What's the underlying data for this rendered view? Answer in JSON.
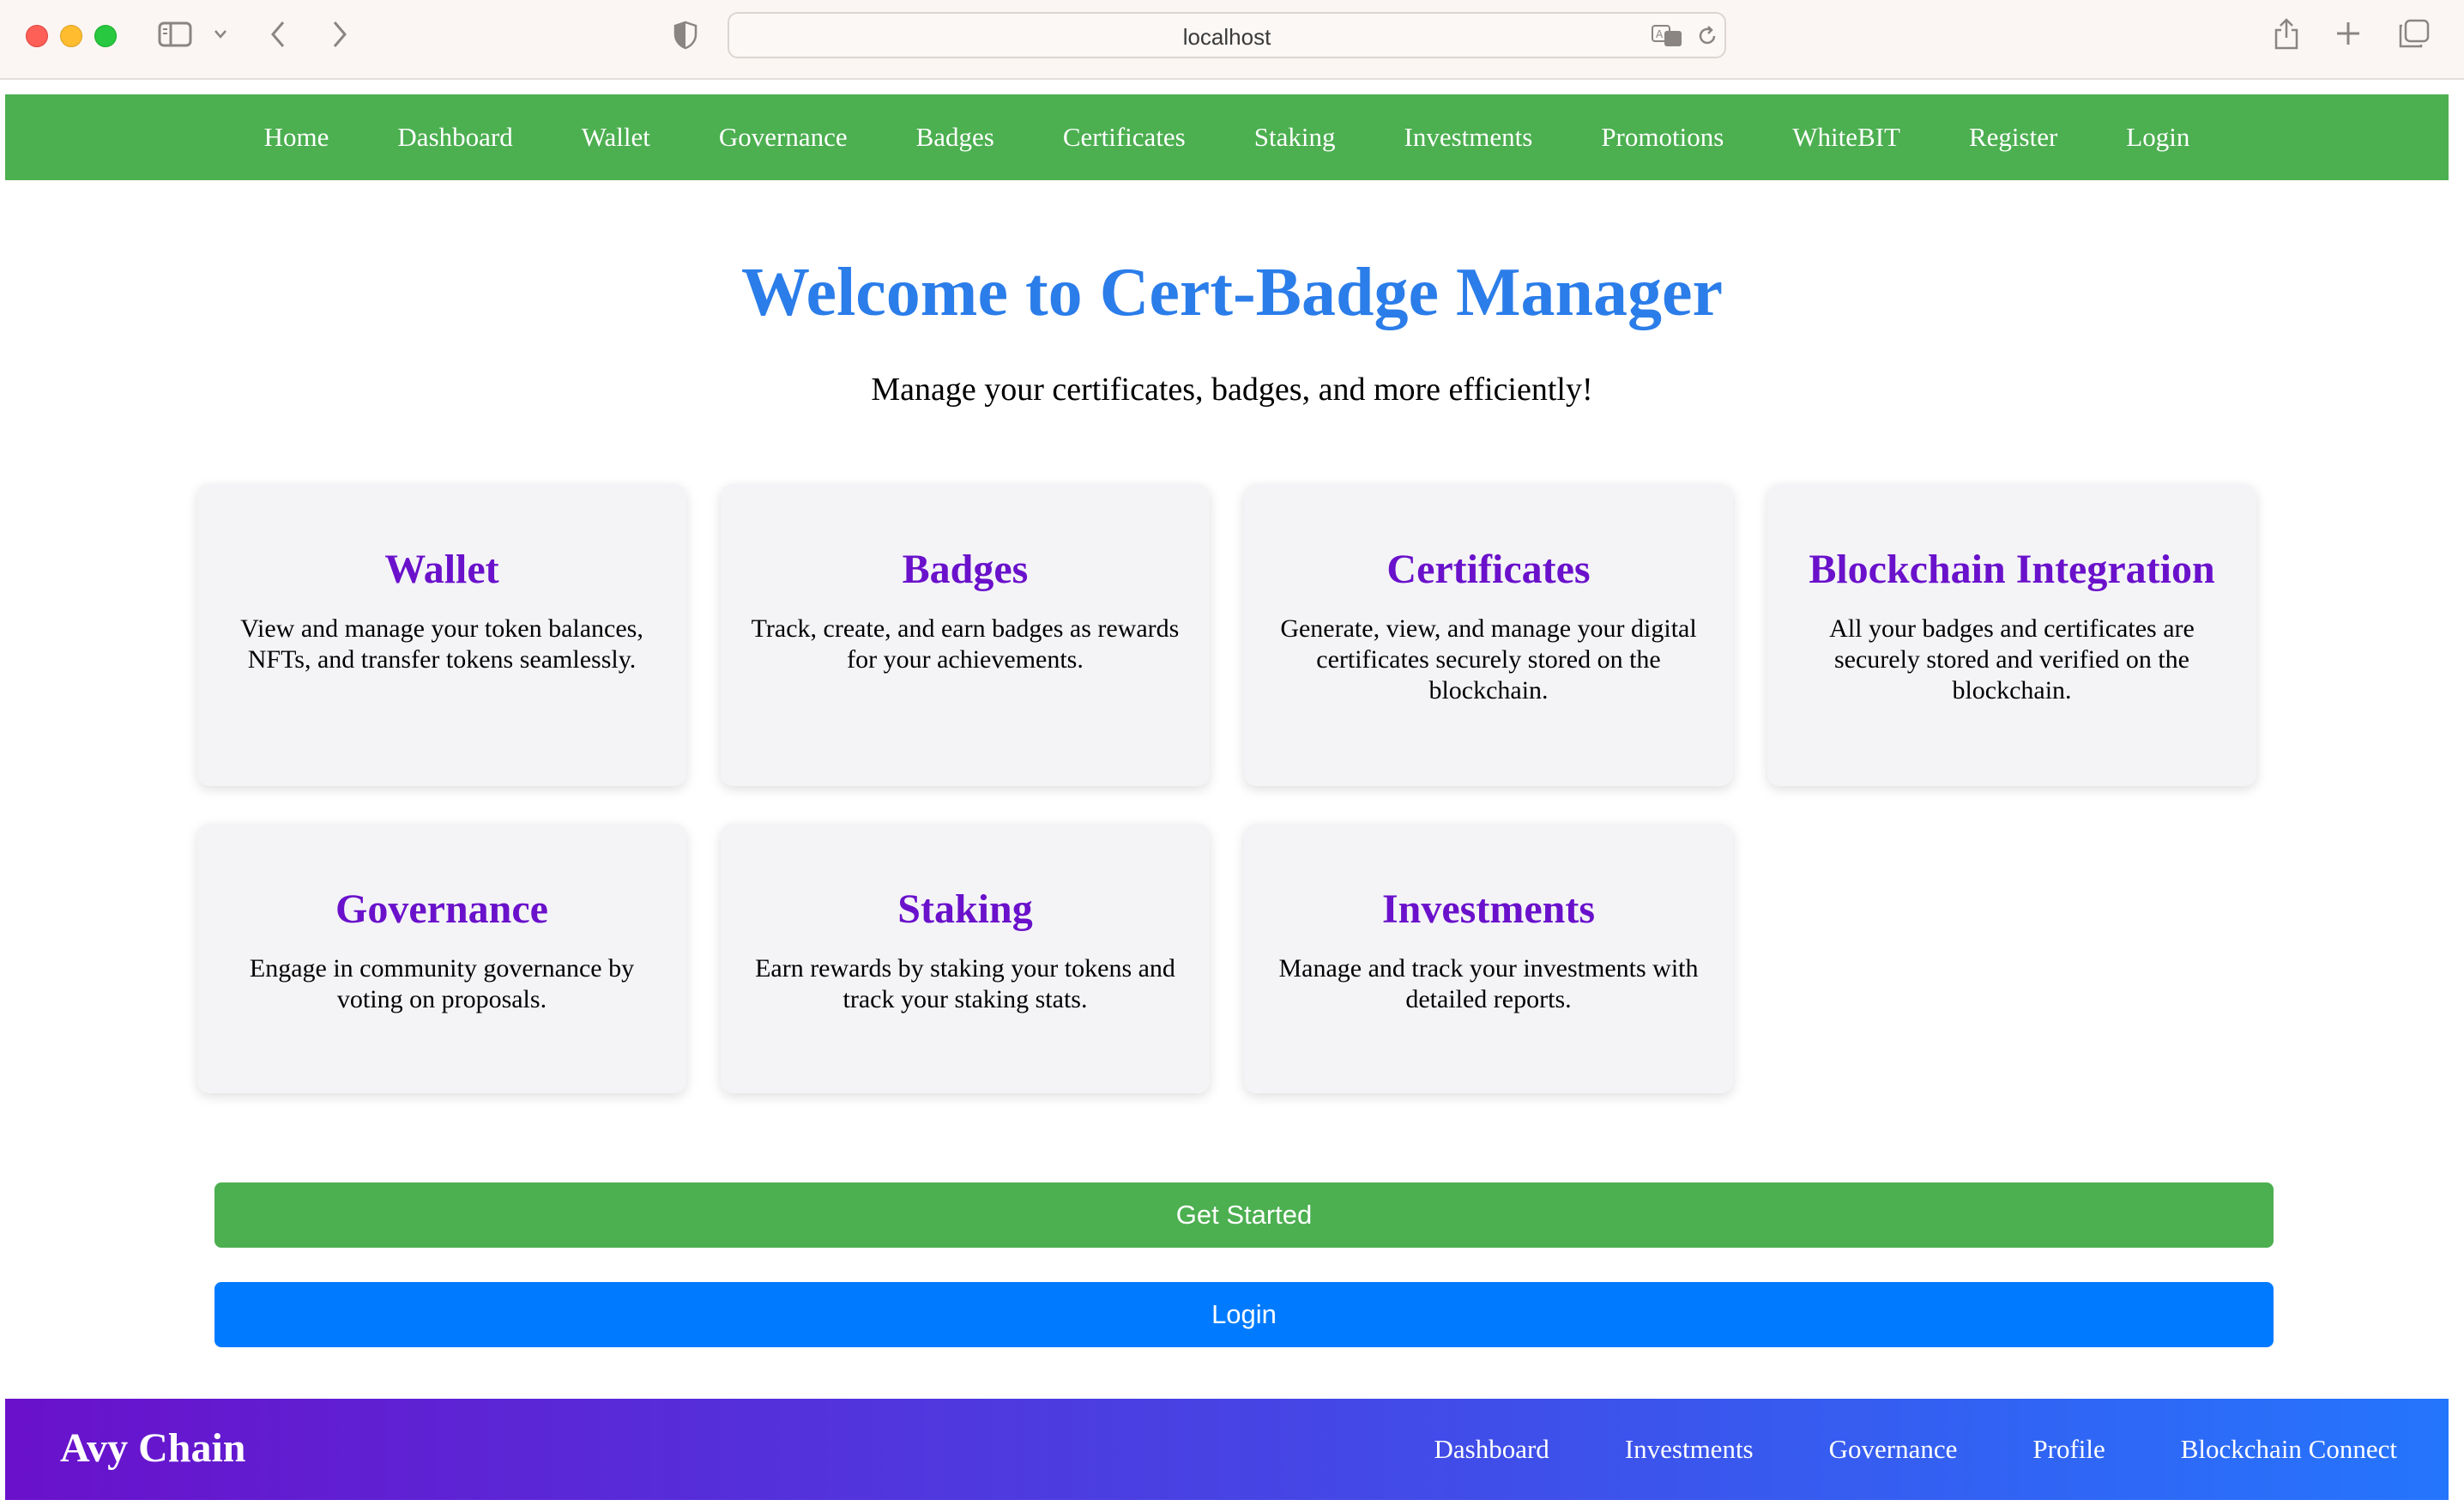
{
  "browser": {
    "url": "localhost",
    "icons": [
      "sidebar-icon",
      "chevron-down-icon",
      "back-icon",
      "forward-icon",
      "shield-icon",
      "translate-icon",
      "reload-icon",
      "share-icon",
      "new-tab-icon",
      "tabs-overview-icon"
    ]
  },
  "nav": {
    "items": [
      "Home",
      "Dashboard",
      "Wallet",
      "Governance",
      "Badges",
      "Certificates",
      "Staking",
      "Investments",
      "Promotions",
      "WhiteBIT",
      "Register",
      "Login"
    ]
  },
  "hero": {
    "title": "Welcome to Cert-Badge Manager",
    "subtitle": "Manage your certificates, badges, and more efficiently!"
  },
  "cards": [
    {
      "title": "Wallet",
      "text": "View and manage your token balances, NFTs, and transfer tokens seamlessly."
    },
    {
      "title": "Badges",
      "text": "Track, create, and earn badges as rewards for your achievements."
    },
    {
      "title": "Certificates",
      "text": "Generate, view, and manage your digital certificates securely stored on the blockchain."
    },
    {
      "title": "Blockchain Integration",
      "text": "All your badges and certificates are securely stored and verified on the blockchain."
    },
    {
      "title": "Governance",
      "text": "Engage in community governance by voting on proposals."
    },
    {
      "title": "Staking",
      "text": "Earn rewards by staking your tokens and track your staking stats."
    },
    {
      "title": "Investments",
      "text": "Manage and track your investments with detailed reports."
    }
  ],
  "actions": {
    "get_started": "Get Started",
    "login": "Login"
  },
  "footer": {
    "brand": "Avy Chain",
    "links": [
      "Dashboard",
      "Investments",
      "Governance",
      "Profile",
      "Blockchain Connect"
    ]
  },
  "colors": {
    "nav_green": "#4caf50",
    "title_blue": "#2b7de9",
    "card_title_purple": "#6a11cb",
    "login_blue": "#007bff",
    "footer_gradient_start": "#6a11cb",
    "footer_gradient_end": "#2575fc"
  }
}
